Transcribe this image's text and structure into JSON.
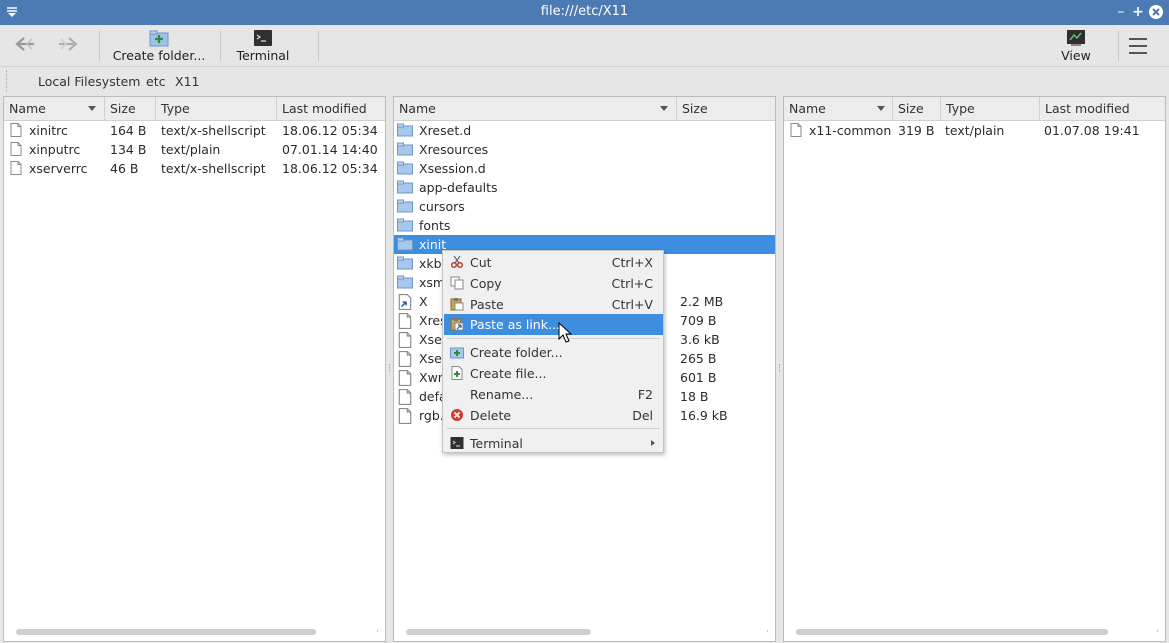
{
  "window": {
    "title": "file:///etc/X11"
  },
  "toolbar": {
    "create_folder_label": "Create folder...",
    "terminal_label": "Terminal",
    "view_label": "View"
  },
  "breadcrumb": [
    "Local Filesystem",
    "etc",
    "X11"
  ],
  "left_pane": {
    "columns": [
      "Name",
      "Size",
      "Type",
      "Last modified"
    ],
    "rows": [
      {
        "name": "xinitrc",
        "size": "164 B",
        "type": "text/x-shellscript",
        "modified": "18.06.12 05:34"
      },
      {
        "name": "xinputrc",
        "size": "134 B",
        "type": "text/plain",
        "modified": "07.01.14 14:40"
      },
      {
        "name": "xserverrc",
        "size": "46 B",
        "type": "text/x-shellscript",
        "modified": "18.06.12 05:34"
      }
    ]
  },
  "middle_pane": {
    "columns": [
      "Name",
      "Size"
    ],
    "rows": [
      {
        "name": "Xreset.d",
        "size": "",
        "kind": "folder"
      },
      {
        "name": "Xresources",
        "size": "",
        "kind": "folder"
      },
      {
        "name": "Xsession.d",
        "size": "",
        "kind": "folder"
      },
      {
        "name": "app-defaults",
        "size": "",
        "kind": "folder"
      },
      {
        "name": "cursors",
        "size": "",
        "kind": "folder"
      },
      {
        "name": "fonts",
        "size": "",
        "kind": "folder"
      },
      {
        "name": "xinit",
        "size": "",
        "kind": "folder",
        "selected": true
      },
      {
        "name": "xkb",
        "size": "",
        "kind": "folder"
      },
      {
        "name": "xsm",
        "size": "",
        "kind": "folder"
      },
      {
        "name": "X",
        "size": "2.2 MB",
        "kind": "link"
      },
      {
        "name": "Xres",
        "size": "709 B",
        "kind": "file"
      },
      {
        "name": "Xses",
        "size": "3.6 kB",
        "kind": "file"
      },
      {
        "name": "Xses",
        "size": "265 B",
        "kind": "file"
      },
      {
        "name": "Xwra",
        "size": "601 B",
        "kind": "file"
      },
      {
        "name": "defa",
        "size": "18 B",
        "kind": "file"
      },
      {
        "name": "rgb.t",
        "size": "16.9 kB",
        "kind": "file"
      }
    ]
  },
  "right_pane": {
    "columns": [
      "Name",
      "Size",
      "Type",
      "Last modified"
    ],
    "rows": [
      {
        "name": "x11-common",
        "size": "319 B",
        "type": "text/plain",
        "modified": "01.07.08 19:41"
      }
    ]
  },
  "context_menu": {
    "items": [
      {
        "label": "Cut",
        "shortcut": "Ctrl+X",
        "icon": "scissors-icon"
      },
      {
        "label": "Copy",
        "shortcut": "Ctrl+C",
        "icon": "copy-icon"
      },
      {
        "label": "Paste",
        "shortcut": "Ctrl+V",
        "icon": "paste-icon"
      },
      {
        "label": "Paste as link...",
        "shortcut": "",
        "icon": "paste-link-icon",
        "highlighted": true
      },
      {
        "label": "Create folder...",
        "shortcut": "",
        "icon": "new-folder-icon"
      },
      {
        "label": "Create file...",
        "shortcut": "",
        "icon": "new-file-icon"
      },
      {
        "label": "Rename...",
        "shortcut": "F2",
        "icon": ""
      },
      {
        "label": "Delete",
        "shortcut": "Del",
        "icon": "delete-icon"
      },
      {
        "label": "Terminal",
        "shortcut": "",
        "icon": "terminal-icon",
        "submenu": true
      }
    ]
  },
  "colors": {
    "titlebar": "#4c7ab3",
    "selection": "#3d8ee0"
  }
}
